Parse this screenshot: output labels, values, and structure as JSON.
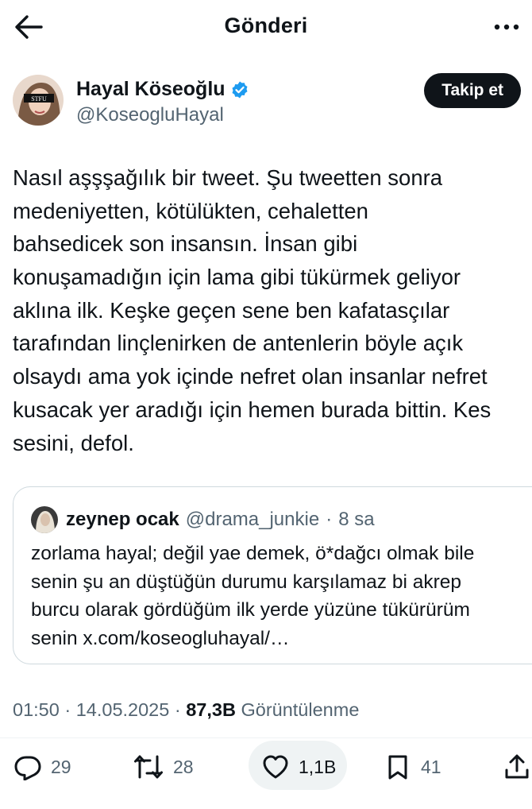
{
  "header": {
    "title": "Gönderi"
  },
  "author": {
    "name": "Hayal Köseoğlu",
    "handle": "@KoseogluHayal",
    "follow_label": "Takip et"
  },
  "tweet": {
    "lines": [
      "Nasıl aşşşağılık bir tweet. Şu tweetten sonra",
      "medeniyetten, kötülükten, cehaletten",
      "bahsedicek son insansın. İnsan gibi",
      "konuşamadığın için lama gibi tükürmek geliyor",
      "aklına ilk. Keşke geçen sene ben kafatasçılar",
      "tarafından linçlenirken de antenlerin böyle açık",
      "olsaydı ama yok içinde nefret olan insanlar nefret",
      "kusacak yer aradığı için hemen burada bittin. Kes",
      "sesini, defol."
    ]
  },
  "quote": {
    "name": "zeynep ocak",
    "handle": "@drama_junkie",
    "separator": "·",
    "time": "8 sa",
    "lines": [
      "zorlama hayal; değil yae demek, ö*dağcı olmak bile",
      "senin şu an düştüğün durumu karşılamaz bi akrep",
      "burcu olarak gördüğüm ilk yerde yüzüne tükürürüm",
      "senin x.com/koseogluhayal/…"
    ]
  },
  "meta": {
    "time": "01:50",
    "sep1": " · ",
    "date": "14.05.2025",
    "sep2": " · ",
    "views_count": "87,3B",
    "views_label": " Görüntülenme"
  },
  "actions": {
    "replies": "29",
    "reposts": "28",
    "likes": "1,1B",
    "bookmarks": "41"
  },
  "icons": {
    "back": "arrow-left-icon",
    "more": "more-horizontal-icon",
    "verified": "verified-badge-icon",
    "reply": "reply-icon",
    "repost": "repost-icon",
    "like": "heart-icon",
    "bookmark": "bookmark-icon",
    "share": "share-icon"
  },
  "colors": {
    "verified": "#1d9bf0",
    "text": "#0f1419",
    "secondary": "#536471"
  }
}
